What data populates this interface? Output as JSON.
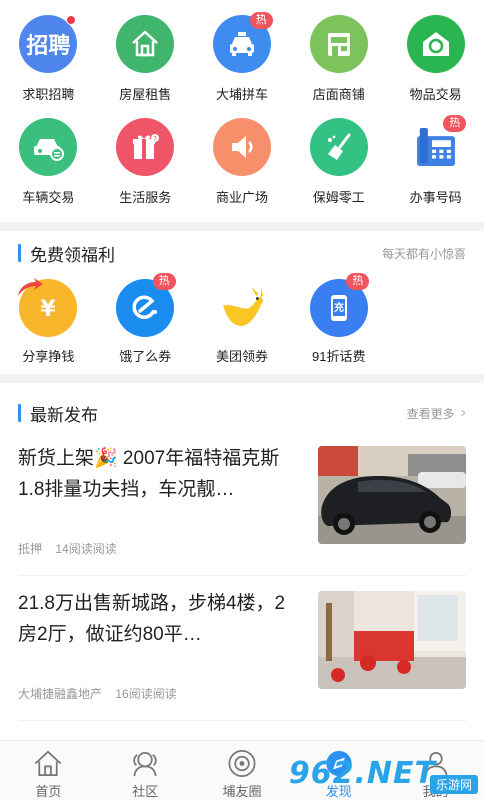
{
  "services": [
    {
      "label": "求职招聘",
      "color": "#4e86ee",
      "icon": "job-icon",
      "badge": "dot",
      "text": "招聘"
    },
    {
      "label": "房屋租售",
      "color": "#3fb66b",
      "icon": "house-icon",
      "badge": ""
    },
    {
      "label": "大埔拼车",
      "color": "#3f8cf0",
      "icon": "car-icon",
      "badge": "热"
    },
    {
      "label": "店面商铺",
      "color": "#6fc35b",
      "icon": "shop-icon",
      "badge": ""
    },
    {
      "label": "物品交易",
      "color": "#29b550",
      "icon": "exchange-icon",
      "badge": ""
    },
    {
      "label": "车辆交易",
      "color": "#3bbf7e",
      "icon": "vehicle-icon",
      "badge": ""
    },
    {
      "label": "生活服务",
      "color": "#f0566a",
      "icon": "service-icon",
      "badge": ""
    },
    {
      "label": "商业广场",
      "color": "#f7906a",
      "icon": "speaker-icon",
      "badge": ""
    },
    {
      "label": "保姆零工",
      "color": "#33c184",
      "icon": "broom-icon",
      "badge": ""
    },
    {
      "label": "办事号码",
      "color": "#ffffff",
      "icon": "phone-icon",
      "badge": "热"
    }
  ],
  "welfare": {
    "title": "免费领福利",
    "subtitle": "每天都有小惊喜",
    "items": [
      {
        "label": "分享挣钱",
        "icon": "yuan-coin-icon",
        "badge": ""
      },
      {
        "label": "饿了么券",
        "icon": "eleme-icon",
        "badge": "热"
      },
      {
        "label": "美团领券",
        "icon": "kangaroo-icon",
        "badge": ""
      },
      {
        "label": "91折话费",
        "icon": "recharge-icon",
        "badge": "热",
        "text": "充"
      }
    ]
  },
  "latest": {
    "title": "最新发布",
    "more": "查看更多",
    "items": [
      {
        "title": "新货上架🎉 2007年福特福克斯1.8排量功夫挡，车况靓…",
        "tag": "抵押",
        "reads": "14阅读阅读",
        "thumb": "car-photo"
      },
      {
        "title": "21.8万出售新城路，步梯4楼，2房2厅，做证约80平…",
        "tag": "大埔捷融鑫地产",
        "reads": "16阅读阅读",
        "thumb": "room-photo"
      }
    ]
  },
  "tabs": [
    {
      "label": "首页",
      "icon": "home-icon",
      "active": false
    },
    {
      "label": "社区",
      "icon": "community-icon",
      "active": false
    },
    {
      "label": "埔友圈",
      "icon": "circle-icon",
      "active": false
    },
    {
      "label": "发现",
      "icon": "discover-icon",
      "active": true
    },
    {
      "label": "我的",
      "icon": "user-icon",
      "active": false
    }
  ],
  "watermark": {
    "brand": "962.NET",
    "sub": "乐游网"
  },
  "colors": {
    "accent": "#2d8ff0",
    "hot": "#f0545d"
  }
}
